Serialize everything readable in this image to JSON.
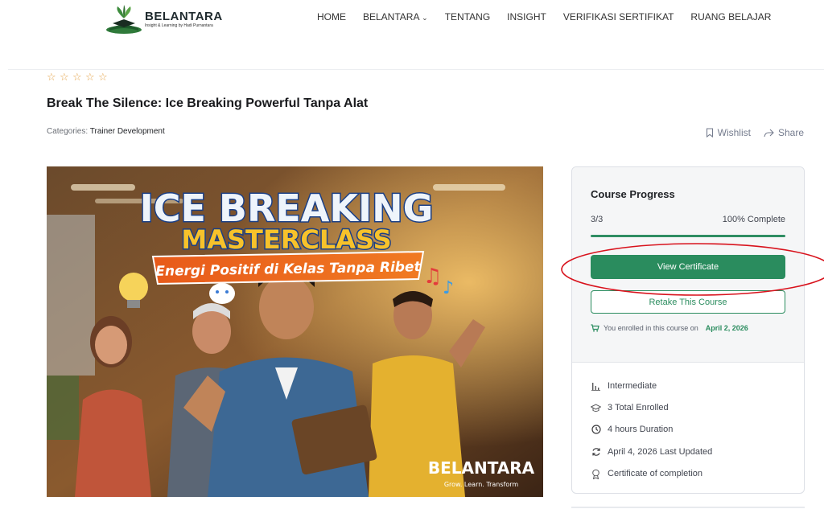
{
  "header": {
    "logo_name": "BELANTARA",
    "logo_tagline": "Insight & Learning by Hadi Purnantara",
    "nav": [
      "HOME",
      "BELANTARA",
      "TENTANG",
      "INSIGHT",
      "VERIFIKASI SERTIFIKAT",
      "RUANG BELAJAR"
    ],
    "nav_dropdown_marker": "⌄"
  },
  "course": {
    "rating_stars": 0,
    "title": "Break The Silence: Ice Breaking Powerful Tanpa Alat",
    "categories_label": "Categories:",
    "category": "Trainer Development",
    "wishlist_label": "Wishlist",
    "share_label": "Share"
  },
  "hero": {
    "headline_1": "ICE BREAKING",
    "headline_2": "MASTERCLASS",
    "ribbon": "Energi Positif di Kelas Tanpa Ribet",
    "brand": "BELANTARA",
    "brand_tagline": "Grow. Learn. Transform"
  },
  "sidebar": {
    "progress_heading": "Course Progress",
    "progress_count": "3/3",
    "progress_percent_label": "100% Complete",
    "progress_value": 1.0,
    "view_certificate_label": "View Certificate",
    "retake_label": "Retake This Course",
    "enrolled_text": "You enrolled in this course on",
    "enrolled_date": "April 2, 2026",
    "meta": [
      {
        "icon": "level-bars-icon",
        "text": "Intermediate"
      },
      {
        "icon": "graduation-cap-icon",
        "text": "3 Total Enrolled"
      },
      {
        "icon": "clock-icon",
        "text": "4 hours  Duration"
      },
      {
        "icon": "refresh-icon",
        "text": "April 4, 2026 Last Updated"
      },
      {
        "icon": "certificate-icon",
        "text": "Certificate of completion"
      }
    ]
  },
  "colors": {
    "accent_green": "#2a8c5e",
    "star": "#e4a44b",
    "annotation_red": "#d8121c"
  }
}
